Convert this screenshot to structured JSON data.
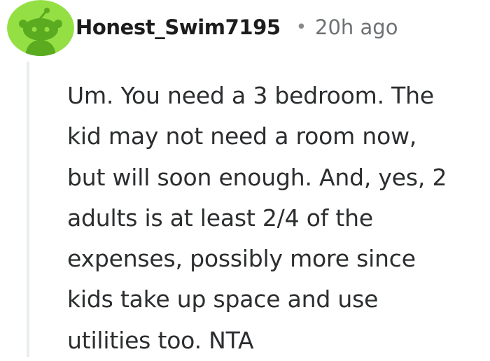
{
  "comment": {
    "author": "Honest_Swim7195",
    "separator": "•",
    "timestamp": "20h ago",
    "avatar_icon": "reddit-snoo-avatar-icon",
    "avatar_bg_color": "#94e044",
    "avatar_figure_color": "#5aab20",
    "body_lines": [
      "Um. You need a 3 bedroom. The",
      "kid may not need a room now,",
      "but will soon enough. And, yes, 2",
      "adults is at least 2/4 of the",
      "expenses, possibly more since",
      "kids take up space and use",
      "utilities too. NTA"
    ]
  }
}
